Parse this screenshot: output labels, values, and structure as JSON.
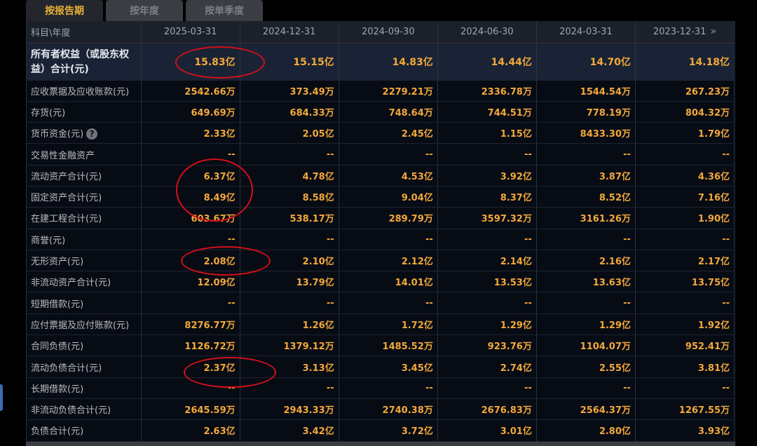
{
  "tabs": [
    {
      "label": "按报告期",
      "active": true
    },
    {
      "label": "按年度",
      "active": false
    },
    {
      "label": "按单季度",
      "active": false
    }
  ],
  "header": {
    "first": "科目\\年度",
    "dates": [
      "2025-03-31",
      "2024-12-31",
      "2024-09-30",
      "2024-06-30",
      "2024-03-31",
      "2023-12-31"
    ],
    "more_icon": "»"
  },
  "rows": [
    {
      "label": "所有者权益（或股东权益）合计(元)",
      "values": [
        "15.83亿",
        "15.15亿",
        "14.83亿",
        "14.44亿",
        "14.70亿",
        "14.18亿"
      ]
    },
    {
      "label": "应收票据及应收账款(元)",
      "values": [
        "2542.66万",
        "373.49万",
        "2279.21万",
        "2336.78万",
        "1544.54万",
        "267.23万"
      ]
    },
    {
      "label": "存货(元)",
      "values": [
        "649.69万",
        "684.33万",
        "748.64万",
        "744.51万",
        "778.19万",
        "804.32万"
      ]
    },
    {
      "label": "货币资金(元)",
      "help": "?",
      "values": [
        "2.33亿",
        "2.05亿",
        "2.45亿",
        "1.15亿",
        "8433.30万",
        "1.79亿"
      ]
    },
    {
      "label": "交易性金融资产",
      "values": [
        "--",
        "--",
        "--",
        "--",
        "--",
        "--"
      ]
    },
    {
      "label": "流动资产合计(元)",
      "values": [
        "6.37亿",
        "4.78亿",
        "4.53亿",
        "3.92亿",
        "3.87亿",
        "4.36亿"
      ]
    },
    {
      "label": "固定资产合计(元)",
      "values": [
        "8.49亿",
        "8.58亿",
        "9.04亿",
        "8.37亿",
        "8.52亿",
        "7.16亿"
      ]
    },
    {
      "label": "在建工程合计(元)",
      "values": [
        "603.67万",
        "538.17万",
        "289.79万",
        "3597.32万",
        "3161.26万",
        "1.90亿"
      ]
    },
    {
      "label": "商誉(元)",
      "values": [
        "--",
        "--",
        "--",
        "--",
        "--",
        "--"
      ]
    },
    {
      "label": "无形资产(元)",
      "values": [
        "2.08亿",
        "2.10亿",
        "2.12亿",
        "2.14亿",
        "2.16亿",
        "2.17亿"
      ]
    },
    {
      "label": "非流动资产合计(元)",
      "values": [
        "12.09亿",
        "13.79亿",
        "14.01亿",
        "13.53亿",
        "13.63亿",
        "13.75亿"
      ]
    },
    {
      "label": "短期借款(元)",
      "values": [
        "--",
        "--",
        "--",
        "--",
        "--",
        "--"
      ]
    },
    {
      "label": "应付票据及应付账款(元)",
      "values": [
        "8276.77万",
        "1.26亿",
        "1.72亿",
        "1.29亿",
        "1.29亿",
        "1.92亿"
      ]
    },
    {
      "label": "合同负债(元)",
      "values": [
        "1126.72万",
        "1379.12万",
        "1485.52万",
        "923.76万",
        "1104.07万",
        "952.41万"
      ]
    },
    {
      "label": "流动负债合计(元)",
      "values": [
        "2.37亿",
        "3.13亿",
        "3.45亿",
        "2.74亿",
        "2.55亿",
        "3.81亿"
      ]
    },
    {
      "label": "长期借款(元)",
      "values": [
        "--",
        "--",
        "--",
        "--",
        "--",
        "--"
      ]
    },
    {
      "label": "非流动负债合计(元)",
      "values": [
        "2645.59万",
        "2943.33万",
        "2740.38万",
        "2676.83万",
        "2564.37万",
        "1267.55万"
      ]
    },
    {
      "label": "负债合计(元)",
      "values": [
        "2.63亿",
        "3.42亿",
        "3.72亿",
        "3.01亿",
        "2.80亿",
        "3.93亿"
      ]
    }
  ],
  "colors": {
    "accent": "#f3a93a",
    "annotation": "#d4101a",
    "tab_active": "#e8b036"
  }
}
